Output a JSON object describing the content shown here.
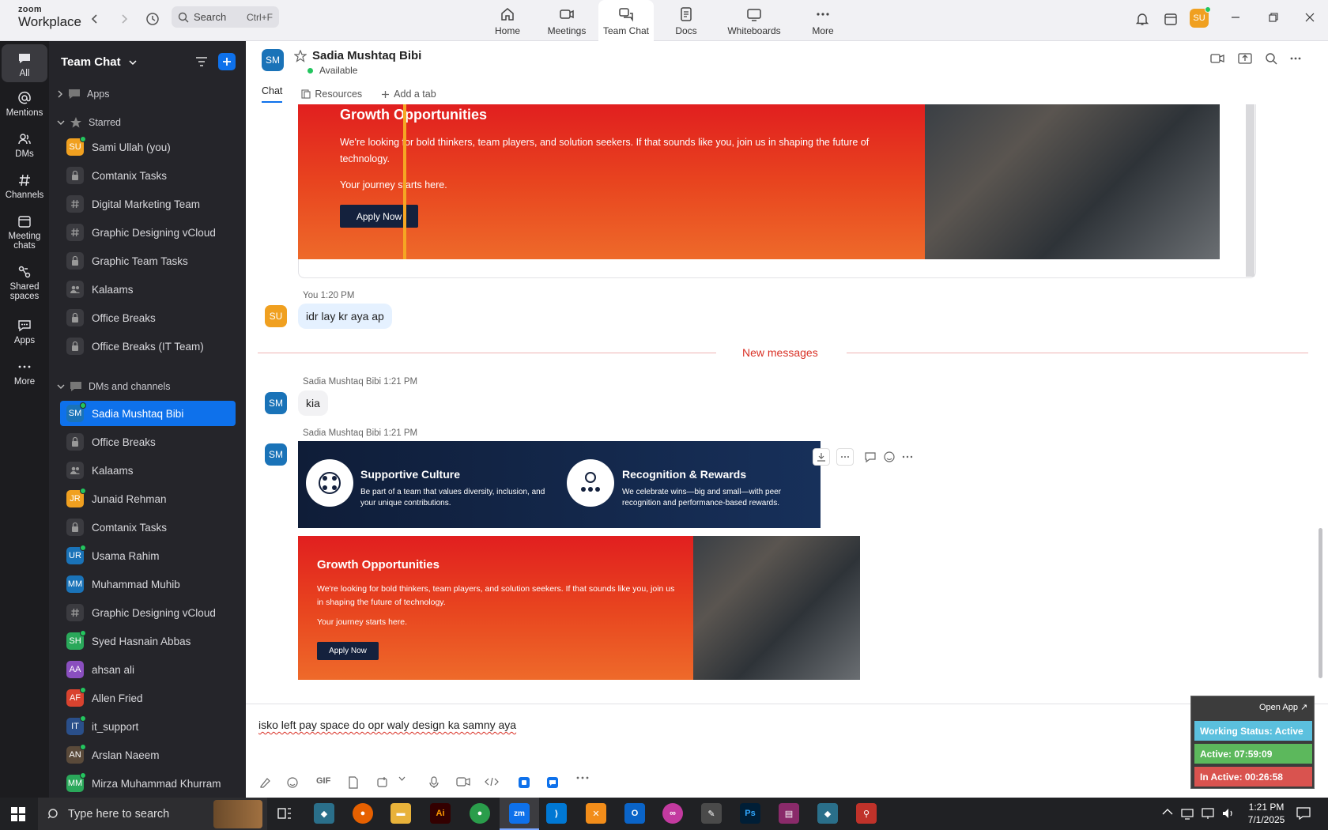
{
  "app": {
    "brand_small": "zoom",
    "brand_big": "Workplace"
  },
  "titlebar": {
    "search_label": "Search",
    "search_shortcut": "Ctrl+F",
    "nav": [
      {
        "label": "Home",
        "icon": "home-icon"
      },
      {
        "label": "Meetings",
        "icon": "video-camera-icon"
      },
      {
        "label": "Team Chat",
        "icon": "chat-bubbles-icon",
        "active": true
      },
      {
        "label": "Docs",
        "icon": "document-icon"
      },
      {
        "label": "Whiteboards",
        "icon": "whiteboard-icon"
      },
      {
        "label": "More",
        "icon": "ellipsis-icon"
      }
    ],
    "user_initials": "SU"
  },
  "rail": [
    {
      "label": "All",
      "icon": "chat-icon",
      "active": true
    },
    {
      "label": "Mentions",
      "icon": "at-icon"
    },
    {
      "label": "DMs",
      "icon": "people-icon"
    },
    {
      "label": "Channels",
      "icon": "hash-icon"
    },
    {
      "label": "Meeting chats",
      "icon": "calendar-icon"
    },
    {
      "label": "Shared spaces",
      "icon": "shared-spaces-icon"
    },
    {
      "label": "Apps",
      "icon": "apps-chat-icon"
    },
    {
      "label": "More",
      "icon": "more-icon"
    }
  ],
  "sidebar": {
    "title": "Team Chat",
    "sections": {
      "apps": "Apps",
      "starred": "Starred",
      "dms": "DMs and channels"
    },
    "starred": [
      {
        "label": "Sami Ullah (you)",
        "type": "avatar",
        "initials": "SU",
        "color": "#f0a020",
        "online": true
      },
      {
        "label": "Comtanix Tasks",
        "type": "lock"
      },
      {
        "label": "Digital Marketing Team",
        "type": "hash"
      },
      {
        "label": "Graphic Designing vCloud",
        "type": "hash"
      },
      {
        "label": "Graphic Team Tasks",
        "type": "lock"
      },
      {
        "label": "Kalaams",
        "type": "group"
      },
      {
        "label": "Office Breaks",
        "type": "lock"
      },
      {
        "label": "Office Breaks (IT Team)",
        "type": "lock"
      }
    ],
    "dms": [
      {
        "label": "Sadia Mushtaq Bibi",
        "type": "avatar",
        "initials": "SM",
        "color": "#1a73b8",
        "online": true,
        "active": true
      },
      {
        "label": "Office Breaks",
        "type": "lock"
      },
      {
        "label": "Kalaams",
        "type": "group"
      },
      {
        "label": "Junaid Rehman",
        "type": "avatar",
        "initials": "JR",
        "color": "#f0a020",
        "online": true
      },
      {
        "label": "Comtanix Tasks",
        "type": "lock"
      },
      {
        "label": "Usama Rahim",
        "type": "avatar",
        "initials": "UR",
        "color": "#1a73b8",
        "online": true
      },
      {
        "label": "Muhammad Muhib",
        "type": "avatar",
        "initials": "MM",
        "color": "#1a73b8",
        "online": false
      },
      {
        "label": "Graphic Designing vCloud",
        "type": "hash"
      },
      {
        "label": "Syed Hasnain Abbas",
        "type": "avatar",
        "initials": "SH",
        "color": "#2aa85a",
        "online": true
      },
      {
        "label": "ahsan ali",
        "type": "avatar",
        "initials": "AA",
        "color": "#8a4fbf",
        "online": false
      },
      {
        "label": "Allen Fried",
        "type": "avatar",
        "initials": "AF",
        "color": "#d9432f",
        "online": true
      },
      {
        "label": "it_support",
        "type": "avatar",
        "initials": "IT",
        "color": "#2a4f8a",
        "online": true
      },
      {
        "label": "Arslan Naeem",
        "type": "avatar",
        "initials": "AN",
        "color": "#5a4a3a",
        "online": true
      },
      {
        "label": "Mirza Muhammad Khurram",
        "type": "avatar",
        "initials": "MM",
        "color": "#2aa85a",
        "online": true
      }
    ]
  },
  "chat": {
    "contact_name": "Sadia Mushtaq Bibi",
    "contact_initials": "SM",
    "status": "Available",
    "tabs": [
      "Chat",
      "Resources",
      "Add a tab"
    ],
    "banner_top": {
      "title": "Growth Opportunities",
      "body": "We're looking for bold thinkers, team players, and solution seekers. If that sounds like you, join us in shaping the future of technology.",
      "tagline": "Your journey starts here.",
      "button": "Apply Now"
    },
    "my_message": {
      "sender": "You",
      "time": "1:20 PM",
      "text": "idr lay kr aya ap",
      "initials": "SU"
    },
    "divider": "New messages",
    "msg1": {
      "sender": "Sadia Mushtaq Bibi",
      "time": "1:21 PM",
      "text": "kia",
      "initials": "SM"
    },
    "msg2": {
      "sender": "Sadia Mushtaq Bibi",
      "time": "1:21 PM",
      "initials": "SM"
    },
    "culture": {
      "title1": "Supportive Culture",
      "body1": "Be part of a team that values diversity, inclusion, and your unique contributions.",
      "title2": "Recognition & Rewards",
      "body2": "We celebrate wins—big and small—with peer recognition and performance-based rewards."
    },
    "banner_bottom": {
      "title": "Growth Opportunities",
      "body": "We're looking for bold thinkers, team players, and solution seekers. If that sounds like you, join us in shaping the future of technology.",
      "tagline": "Your journey starts here.",
      "button": "Apply Now"
    },
    "composer_text": "isko left pay space do opr waly design ka samny aya",
    "gif_label": "GIF"
  },
  "widget": {
    "open_app": "Open App ↗",
    "working_status": "Working Status: Active",
    "active": "Active: 07:59:09",
    "inactive": "In Active: 00:26:58",
    "colors": {
      "status": "#5bc0de",
      "active": "#5cb85c",
      "inactive": "#d9534f"
    }
  },
  "taskbar": {
    "search_placeholder": "Type here to search",
    "time": "1:21 PM",
    "date": "7/1/2025"
  }
}
